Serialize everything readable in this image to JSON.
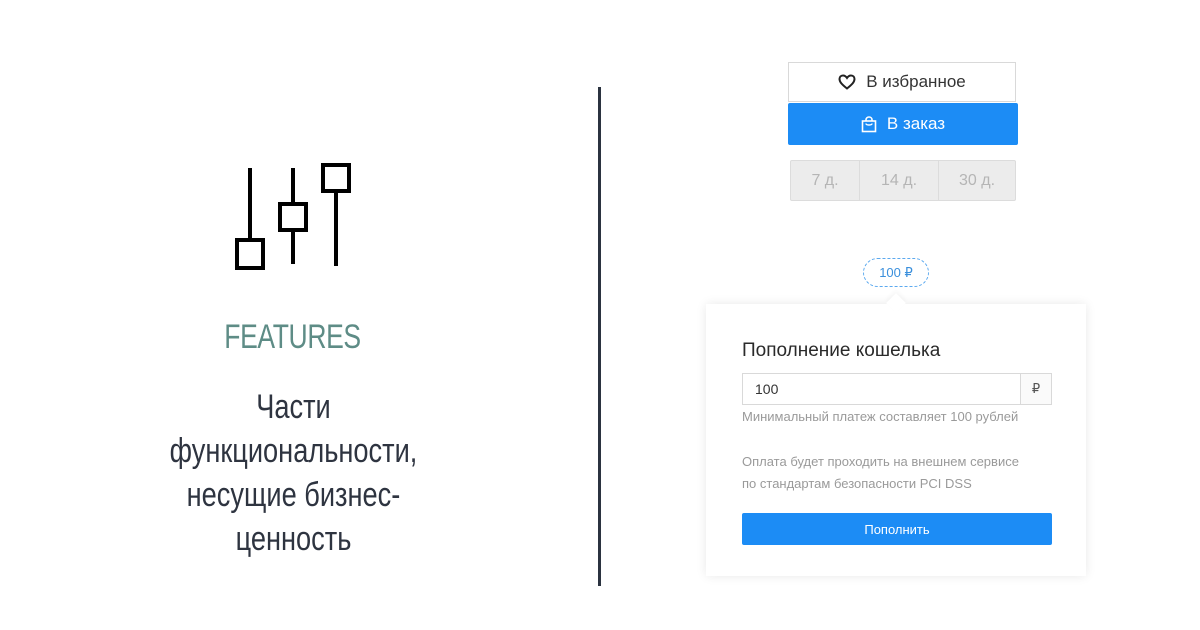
{
  "left": {
    "icon": "sliders-icon",
    "title": "FEATURES",
    "description_lines": [
      "Части функциональности,",
      "несущие бизнес-ценность"
    ]
  },
  "colors": {
    "accent": "#1c8cf5",
    "title": "#5e8c86",
    "text_dark": "#2e3440",
    "divider": "#2b3340"
  },
  "product_actions": {
    "favorite_label": "В избранное",
    "favorite_icon": "heart-icon",
    "order_label": "В заказ",
    "order_icon": "shopping-bag-icon",
    "periods": [
      "7 д.",
      "14 д.",
      "30 д."
    ]
  },
  "amount_chip": "100 ₽",
  "wallet": {
    "title": "Пополнение кошелька",
    "amount_value": "100",
    "currency": "₽",
    "min_hint": "Минимальный платеж составляет 100 рублей",
    "note_lines": [
      "Оплата будет проходить на внешнем сервисе",
      "по стандартам безопасности PCI DSS"
    ],
    "submit_label": "Пополнить"
  }
}
